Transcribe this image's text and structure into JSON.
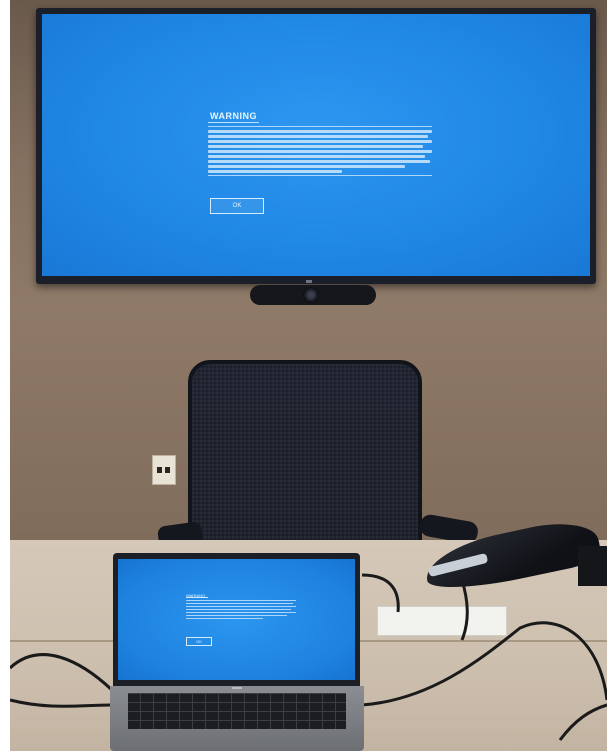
{
  "tv": {
    "warning_title": "WARNING",
    "ok_label": "OK"
  },
  "laptop": {
    "warning_title": "WARNING",
    "ok_label": "OK"
  },
  "colors": {
    "screen_blue": "#1f86e4",
    "wall": "#8f7a68",
    "table": "#d6c8b8"
  }
}
